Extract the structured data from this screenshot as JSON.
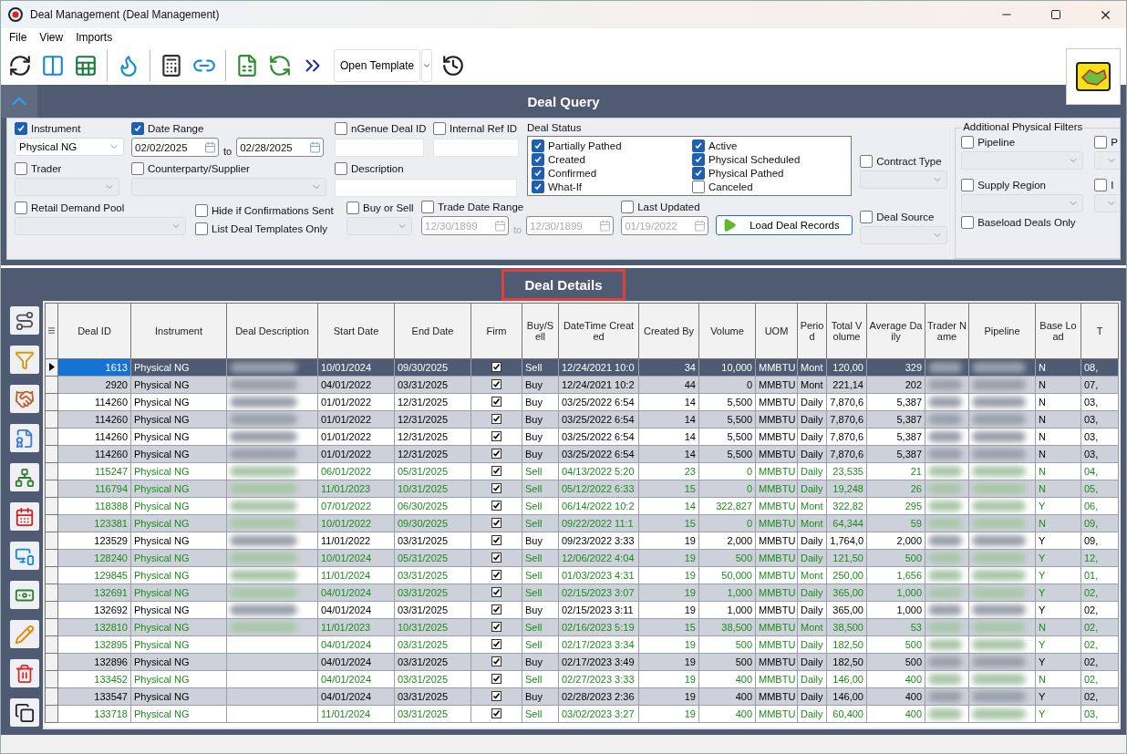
{
  "window": {
    "title": "Deal Management (Deal Management)"
  },
  "menu": [
    "File",
    "View",
    "Imports"
  ],
  "toolbar": {
    "template_button": "Open Template"
  },
  "query": {
    "title": "Deal Query",
    "instrument": {
      "label": "Instrument",
      "checked": true,
      "value": "Physical NG"
    },
    "date_range": {
      "label": "Date Range",
      "checked": true,
      "from": "02/02/2025",
      "sep": "to",
      "to": "02/28/2025"
    },
    "ngenue_id": {
      "label": "nGenue Deal ID",
      "checked": false
    },
    "internal_ref": {
      "label": "Internal Ref ID",
      "checked": false
    },
    "trader": {
      "label": "Trader",
      "checked": false
    },
    "counterparty": {
      "label": "Counterparty/Supplier",
      "checked": false
    },
    "description": {
      "label": "Description",
      "checked": false
    },
    "retail_pool": {
      "label": "Retail Demand Pool",
      "checked": false
    },
    "hide_confirmations": {
      "label": "Hide if Confirmations Sent",
      "checked": false
    },
    "list_templates": {
      "label": "List Deal Templates Only",
      "checked": false
    },
    "buy_sell": {
      "label": "Buy or Sell",
      "checked": false
    },
    "trade_date_range": {
      "label": "Trade Date Range",
      "checked": false,
      "from": "12/30/1899",
      "sep": "to",
      "to": "12/30/1899"
    },
    "last_updated": {
      "label": "Last Updated",
      "checked": false,
      "value": "01/19/2022"
    },
    "load_button": "Load Deal Records",
    "deal_status": {
      "label": "Deal Status",
      "items": [
        {
          "label": "Partially Pathed",
          "checked": true
        },
        {
          "label": "Created",
          "checked": true
        },
        {
          "label": "Confirmed",
          "checked": true
        },
        {
          "label": "What-If",
          "checked": true
        },
        {
          "label": "Active",
          "checked": true
        },
        {
          "label": "Physical Scheduled",
          "checked": true
        },
        {
          "label": "Physical Pathed",
          "checked": true
        },
        {
          "label": "Canceled",
          "checked": false
        }
      ]
    },
    "contract_type": {
      "label": "Contract Type",
      "checked": false
    },
    "deal_source": {
      "label": "Deal Source",
      "checked": false
    },
    "physical_filters": {
      "title": "Additional Physical Filters",
      "items": [
        {
          "label": "Pipeline",
          "checked": false
        },
        {
          "label": "P",
          "checked": false
        },
        {
          "label": "Supply Region",
          "checked": false
        },
        {
          "label": "I",
          "checked": false
        }
      ],
      "baseload": {
        "label": "Baseload Deals Only",
        "checked": false
      }
    }
  },
  "details": {
    "title": "Deal Details",
    "table": {
      "columns": [
        {
          "label": "Deal ID",
          "kind": "number"
        },
        {
          "label": "Instrument",
          "kind": "text"
        },
        {
          "label": "Deal Description",
          "kind": "blurred"
        },
        {
          "label": "Start Date",
          "kind": "text"
        },
        {
          "label": "End Date",
          "kind": "text"
        },
        {
          "label": "Firm",
          "kind": "check"
        },
        {
          "label": "Buy/Sell",
          "kind": "text"
        },
        {
          "label": "DateTime Created",
          "kind": "text"
        },
        {
          "label": "Created By",
          "kind": "number"
        },
        {
          "label": "Volume",
          "kind": "number"
        },
        {
          "label": "UOM",
          "kind": "text"
        },
        {
          "label": "Period",
          "kind": "text"
        },
        {
          "label": "Total Volume",
          "kind": "number"
        },
        {
          "label": "Average Daily",
          "kind": "number"
        },
        {
          "label": "Trader Name",
          "kind": "hidden"
        },
        {
          "label": "Pipeline",
          "kind": "hidden"
        },
        {
          "label": "Base Load",
          "kind": "text"
        },
        {
          "label": "T",
          "kind": "text"
        }
      ],
      "rows": [
        {
          "selected": true,
          "highlighted": false,
          "redacted": true,
          "cells": [
            "1613",
            "Physical NG",
            "",
            "10/01/2024",
            "09/30/2025",
            true,
            "Sell",
            "12/24/2021 10:0",
            "34",
            "10,000",
            "MMBTU",
            "Mont",
            "120,00",
            "329",
            "",
            "",
            "N",
            "08,"
          ]
        },
        {
          "selected": false,
          "highlighted": false,
          "redacted": true,
          "cells": [
            "2920",
            "Physical NG",
            "",
            "04/01/2022",
            "03/31/2025",
            true,
            "Buy",
            "12/24/2021 10:2",
            "44",
            "0",
            "MMBTU",
            "Mont",
            "221,14",
            "202",
            "",
            "",
            "N",
            "07,"
          ]
        },
        {
          "selected": false,
          "highlighted": false,
          "redacted": true,
          "cells": [
            "114260",
            "Physical NG",
            "",
            "01/01/2022",
            "12/31/2025",
            true,
            "Buy",
            "03/25/2022 6:54",
            "14",
            "5,500",
            "MMBTU",
            "Daily",
            "7,870,6",
            "5,387",
            "",
            "",
            "N",
            "03,"
          ]
        },
        {
          "selected": false,
          "highlighted": false,
          "redacted": true,
          "cells": [
            "114260",
            "Physical NG",
            "",
            "01/01/2022",
            "12/31/2025",
            true,
            "Buy",
            "03/25/2022 6:54",
            "14",
            "5,500",
            "MMBTU",
            "Daily",
            "7,870,6",
            "5,387",
            "",
            "",
            "N",
            "03,"
          ]
        },
        {
          "selected": false,
          "highlighted": false,
          "redacted": true,
          "cells": [
            "114260",
            "Physical NG",
            "",
            "01/01/2022",
            "12/31/2025",
            true,
            "Buy",
            "03/25/2022 6:54",
            "14",
            "5,500",
            "MMBTU",
            "Daily",
            "7,870,6",
            "5,387",
            "",
            "",
            "N",
            "03,"
          ]
        },
        {
          "selected": false,
          "highlighted": false,
          "redacted": true,
          "cells": [
            "114260",
            "Physical NG",
            "",
            "01/01/2022",
            "12/31/2025",
            true,
            "Buy",
            "03/25/2022 6:54",
            "14",
            "5,500",
            "MMBTU",
            "Daily",
            "7,870,6",
            "5,387",
            "",
            "",
            "N",
            "03,"
          ]
        },
        {
          "selected": false,
          "highlighted": true,
          "redacted": true,
          "cells": [
            "115247",
            "Physical NG",
            "",
            "06/01/2022",
            "05/31/2025",
            true,
            "Sell",
            "04/13/2022 5:20",
            "23",
            "0",
            "MMBTU",
            "Daily",
            "23,535",
            "21",
            "",
            "",
            "N",
            "04,"
          ]
        },
        {
          "selected": false,
          "highlighted": true,
          "redacted": true,
          "cells": [
            "116794",
            "Physical NG",
            "",
            "11/01/2023",
            "10/31/2025",
            true,
            "Sell",
            "05/12/2022 6:33",
            "15",
            "0",
            "MMBTU",
            "Daily",
            "19,248",
            "26",
            "",
            "",
            "N",
            "05,"
          ]
        },
        {
          "selected": false,
          "highlighted": true,
          "redacted": true,
          "cells": [
            "118388",
            "Physical NG",
            "",
            "07/01/2022",
            "06/30/2025",
            true,
            "Sell",
            "06/14/2022 10:2",
            "14",
            "322,827",
            "MMBTU",
            "Mont",
            "322,82",
            "295",
            "",
            "",
            "Y",
            "06,"
          ]
        },
        {
          "selected": false,
          "highlighted": true,
          "redacted": true,
          "cells": [
            "123381",
            "Physical NG",
            "",
            "10/01/2022",
            "09/30/2025",
            true,
            "Sell",
            "09/22/2022 11:1",
            "15",
            "0",
            "MMBTU",
            "Mont",
            "64,344",
            "59",
            "",
            "",
            "N",
            "09,"
          ]
        },
        {
          "selected": false,
          "highlighted": false,
          "redacted": true,
          "cells": [
            "123529",
            "Physical NG",
            "",
            "11/01/2022",
            "03/31/2025",
            true,
            "Buy",
            "09/23/2022 3:33",
            "19",
            "2,000",
            "MMBTU",
            "Daily",
            "1,764,0",
            "2,000",
            "",
            "",
            "Y",
            "09,"
          ]
        },
        {
          "selected": false,
          "highlighted": true,
          "redacted": true,
          "cells": [
            "128240",
            "Physical NG",
            "",
            "10/01/2024",
            "05/31/2025",
            true,
            "Sell",
            "12/06/2022 4:04",
            "19",
            "500",
            "MMBTU",
            "Daily",
            "121,50",
            "500",
            "",
            "",
            "Y",
            "12,"
          ]
        },
        {
          "selected": false,
          "highlighted": true,
          "redacted": true,
          "cells": [
            "129845",
            "Physical NG",
            "",
            "11/01/2024",
            "03/31/2025",
            true,
            "Sell",
            "01/03/2023 4:31",
            "19",
            "50,000",
            "MMBTU",
            "Mont",
            "250,00",
            "1,656",
            "",
            "",
            "Y",
            "01,"
          ]
        },
        {
          "selected": false,
          "highlighted": true,
          "redacted": true,
          "cells": [
            "132691",
            "Physical NG",
            "",
            "04/01/2024",
            "03/31/2025",
            true,
            "Sell",
            "02/15/2023 3:07",
            "19",
            "1,000",
            "MMBTU",
            "Daily",
            "365,00",
            "1,000",
            "",
            "",
            "Y",
            "02,"
          ]
        },
        {
          "selected": false,
          "highlighted": false,
          "redacted": true,
          "cells": [
            "132692",
            "Physical NG",
            "",
            "04/01/2024",
            "03/31/2025",
            true,
            "Buy",
            "02/15/2023 3:11",
            "19",
            "1,000",
            "MMBTU",
            "Daily",
            "365,00",
            "1,000",
            "",
            "",
            "Y",
            "02,"
          ]
        },
        {
          "selected": false,
          "highlighted": true,
          "redacted": true,
          "cells": [
            "132810",
            "Physical NG",
            "",
            "11/01/2023",
            "10/31/2025",
            true,
            "Sell",
            "02/16/2023 5:19",
            "15",
            "38,500",
            "MMBTU",
            "Mont",
            "38,500",
            "53",
            "",
            "",
            "N",
            "02,"
          ]
        },
        {
          "selected": false,
          "highlighted": true,
          "redacted": false,
          "cells": [
            "132895",
            "Physical NG",
            "",
            "04/01/2024",
            "03/31/2025",
            true,
            "Sell",
            "02/17/2023 3:34",
            "19",
            "500",
            "MMBTU",
            "Daily",
            "182,50",
            "500",
            "",
            "",
            "Y",
            "02,"
          ]
        },
        {
          "selected": false,
          "highlighted": false,
          "redacted": false,
          "cells": [
            "132896",
            "Physical NG",
            "",
            "04/01/2024",
            "03/31/2025",
            true,
            "Buy",
            "02/17/2023 3:49",
            "19",
            "500",
            "MMBTU",
            "Daily",
            "182,50",
            "500",
            "",
            "",
            "Y",
            "02,"
          ]
        },
        {
          "selected": false,
          "highlighted": true,
          "redacted": false,
          "cells": [
            "133452",
            "Physical NG",
            "",
            "04/01/2024",
            "03/31/2025",
            true,
            "Sell",
            "02/27/2023 3:33",
            "19",
            "400",
            "MMBTU",
            "Daily",
            "146,00",
            "400",
            "",
            "",
            "N",
            "02,"
          ]
        },
        {
          "selected": false,
          "highlighted": false,
          "redacted": false,
          "cells": [
            "133547",
            "Physical NG",
            "",
            "04/01/2024",
            "03/31/2025",
            true,
            "Buy",
            "02/28/2023 2:36",
            "19",
            "400",
            "MMBTU",
            "Daily",
            "146,00",
            "400",
            "",
            "",
            "Y",
            "02,"
          ]
        },
        {
          "selected": false,
          "highlighted": true,
          "redacted": false,
          "cells": [
            "133718",
            "Physical NG",
            "",
            "11/01/2024",
            "03/31/2025",
            true,
            "Sell",
            "03/02/2023 3:27",
            "19",
            "400",
            "MMBTU",
            "Daily",
            "60,400",
            "400",
            "",
            "",
            "Y",
            "03,"
          ]
        }
      ]
    }
  }
}
